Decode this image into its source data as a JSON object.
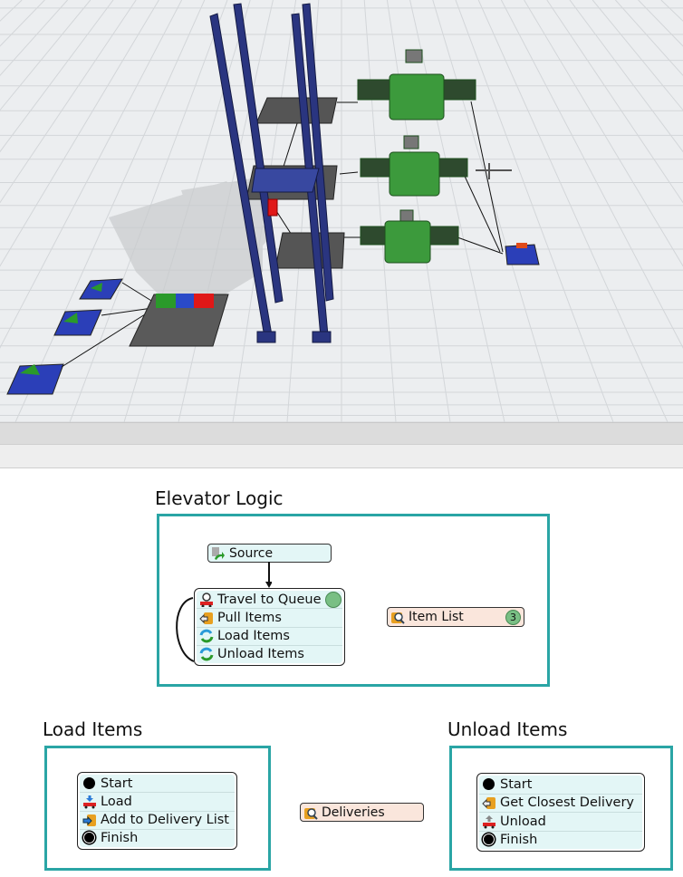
{
  "elevator_logic": {
    "title": "Elevator Logic",
    "source": {
      "label": "Source",
      "icon": "source-icon"
    },
    "activities": [
      {
        "label": "Travel to Queue",
        "icon": "travel-icon"
      },
      {
        "label": "Pull Items",
        "icon": "pull-list-icon"
      },
      {
        "label": "Load Items",
        "icon": "subflow-icon"
      },
      {
        "label": "Unload Items",
        "icon": "subflow-icon"
      }
    ],
    "item_list": {
      "label": "Item List",
      "count": "3",
      "icon": "list-icon"
    }
  },
  "load_items": {
    "title": "Load Items",
    "activities": [
      {
        "label": "Start",
        "icon": "start-icon"
      },
      {
        "label": "Load",
        "icon": "load-icon"
      },
      {
        "label": "Add to Delivery List",
        "icon": "push-list-icon"
      },
      {
        "label": "Finish",
        "icon": "finish-icon"
      }
    ]
  },
  "deliveries": {
    "label": "Deliveries",
    "icon": "list-icon"
  },
  "unload_items": {
    "title": "Unload Items",
    "activities": [
      {
        "label": "Start",
        "icon": "start-icon"
      },
      {
        "label": "Get Closest Delivery",
        "icon": "pull-list-icon"
      },
      {
        "label": "Unload",
        "icon": "unload-icon"
      },
      {
        "label": "Finish",
        "icon": "finish-icon"
      }
    ]
  },
  "colors": {
    "frame": "#2aa5a5",
    "activity_fill": "#e3f6f6",
    "resource_fill": "#fae6dc",
    "token": "#79bf84"
  }
}
